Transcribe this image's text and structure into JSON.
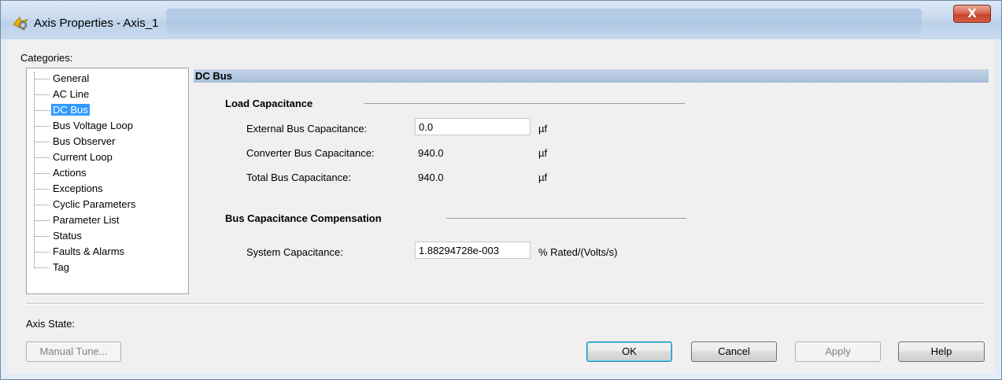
{
  "window": {
    "title": "Axis Properties - Axis_1",
    "close_label": "X"
  },
  "categories": {
    "label": "Categories:",
    "items": [
      {
        "label": "General"
      },
      {
        "label": "AC Line"
      },
      {
        "label": "DC Bus"
      },
      {
        "label": "Bus Voltage Loop"
      },
      {
        "label": "Bus Observer"
      },
      {
        "label": "Current Loop"
      },
      {
        "label": "Actions"
      },
      {
        "label": "Exceptions"
      },
      {
        "label": "Cyclic Parameters"
      },
      {
        "label": "Parameter List"
      },
      {
        "label": "Status"
      },
      {
        "label": "Faults & Alarms"
      },
      {
        "label": "Tag"
      }
    ],
    "selected": "DC Bus"
  },
  "panel": {
    "title": "DC Bus",
    "load_capacitance": {
      "title": "Load Capacitance",
      "external_label": "External Bus Capacitance:",
      "external_value": "0.0",
      "external_unit": "µf",
      "converter_label": "Converter Bus Capacitance:",
      "converter_value": "940.0",
      "converter_unit": "µf",
      "total_label": "Total Bus Capacitance:",
      "total_value": "940.0",
      "total_unit": "µf"
    },
    "compensation": {
      "title": "Bus Capacitance Compensation",
      "system_label": "System Capacitance:",
      "system_value": "1.88294728e-003",
      "system_unit": "% Rated/(Volts/s)"
    }
  },
  "footer": {
    "axis_state_label": "Axis State:",
    "manual_tune": "Manual Tune...",
    "ok": "OK",
    "cancel": "Cancel",
    "apply": "Apply",
    "help": "Help"
  }
}
